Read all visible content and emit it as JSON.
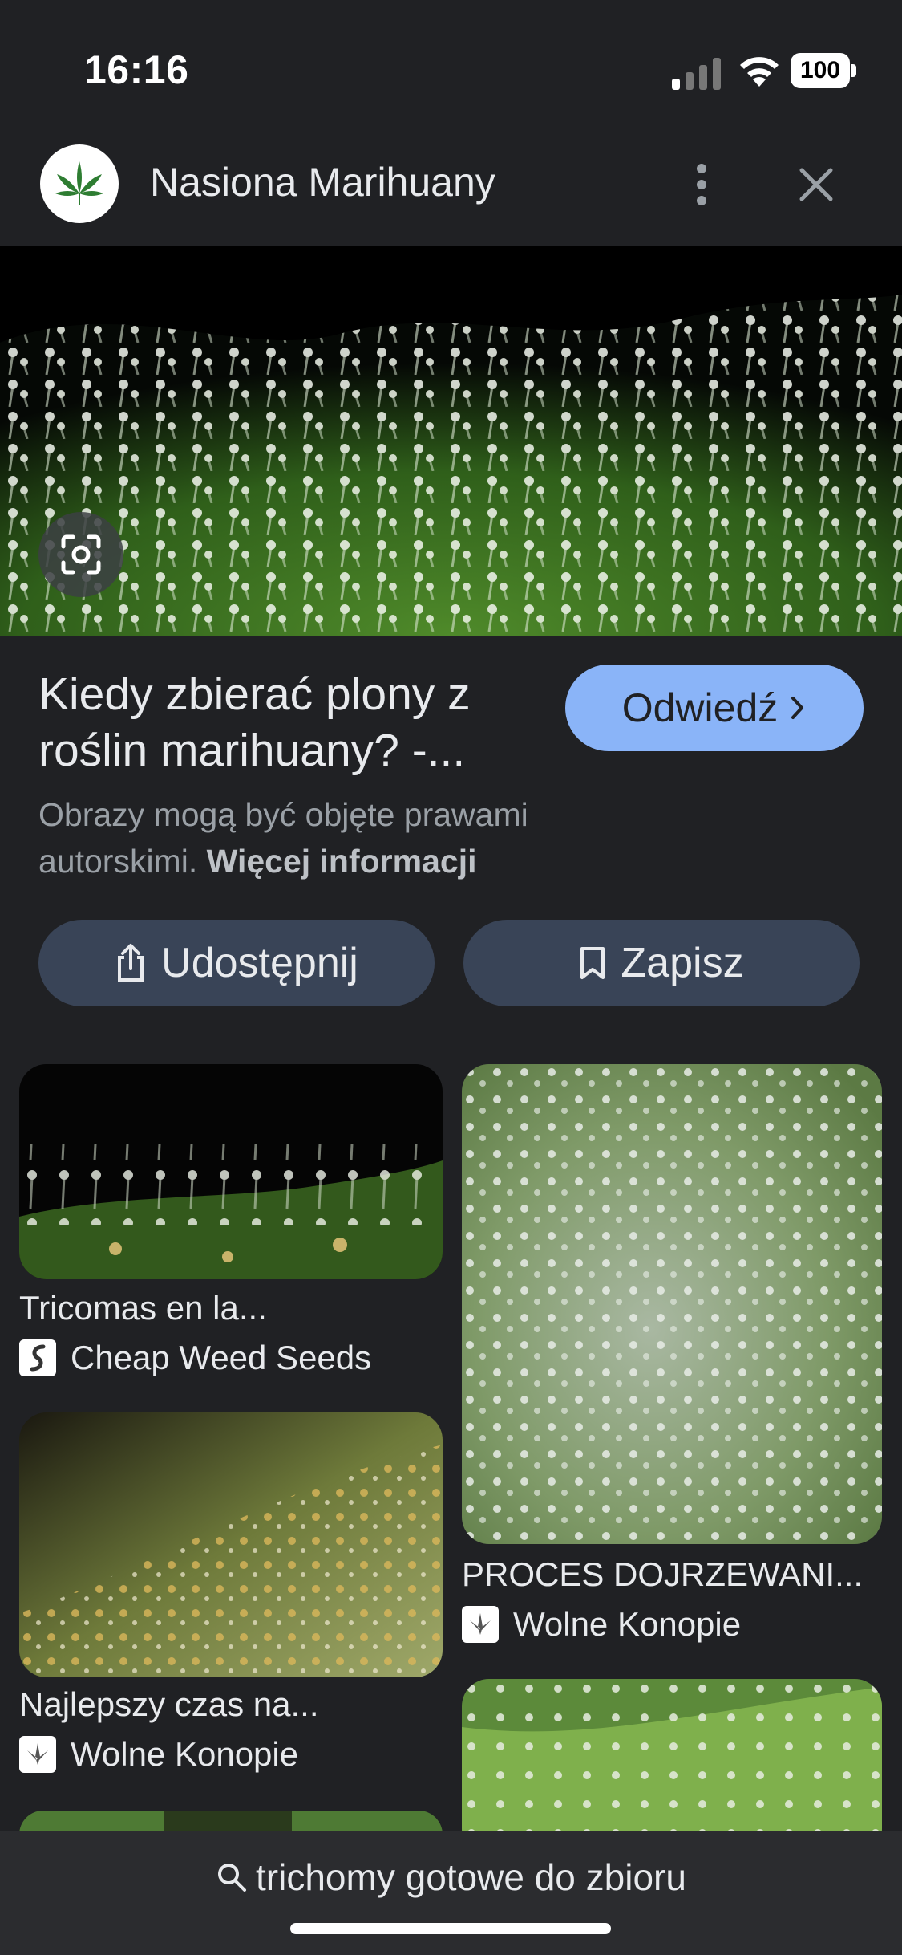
{
  "status_bar": {
    "time": "16:16",
    "battery": "100"
  },
  "header": {
    "site_name": "Nasiona Marihuany",
    "logo_icon": "cannabis-leaf-icon"
  },
  "result": {
    "title_line1": "Kiedy zbierać plony z",
    "title_line2": "roślin marihuany? -...",
    "visit_label": "Odwiedź",
    "copyright_text": "Obrazy mogą być objęte prawami autorskimi.",
    "more_info_label": "Więcej informacji"
  },
  "actions": {
    "share_label": "Udostępnij",
    "save_label": "Zapisz"
  },
  "related": [
    {
      "caption": "Tricomas en la...",
      "source": "Cheap Weed Seeds"
    },
    {
      "caption": "PROCES DOJRZEWANI...",
      "source": "Wolne Konopie"
    },
    {
      "caption": "Najlepszy czas na...",
      "source": "Wolne Konopie"
    }
  ],
  "bottom_search": {
    "query": "trichomy gotowe do zbioru"
  },
  "colors": {
    "accent": "#8ab4f8",
    "pill_bg": "#394457",
    "background": "#202124"
  }
}
